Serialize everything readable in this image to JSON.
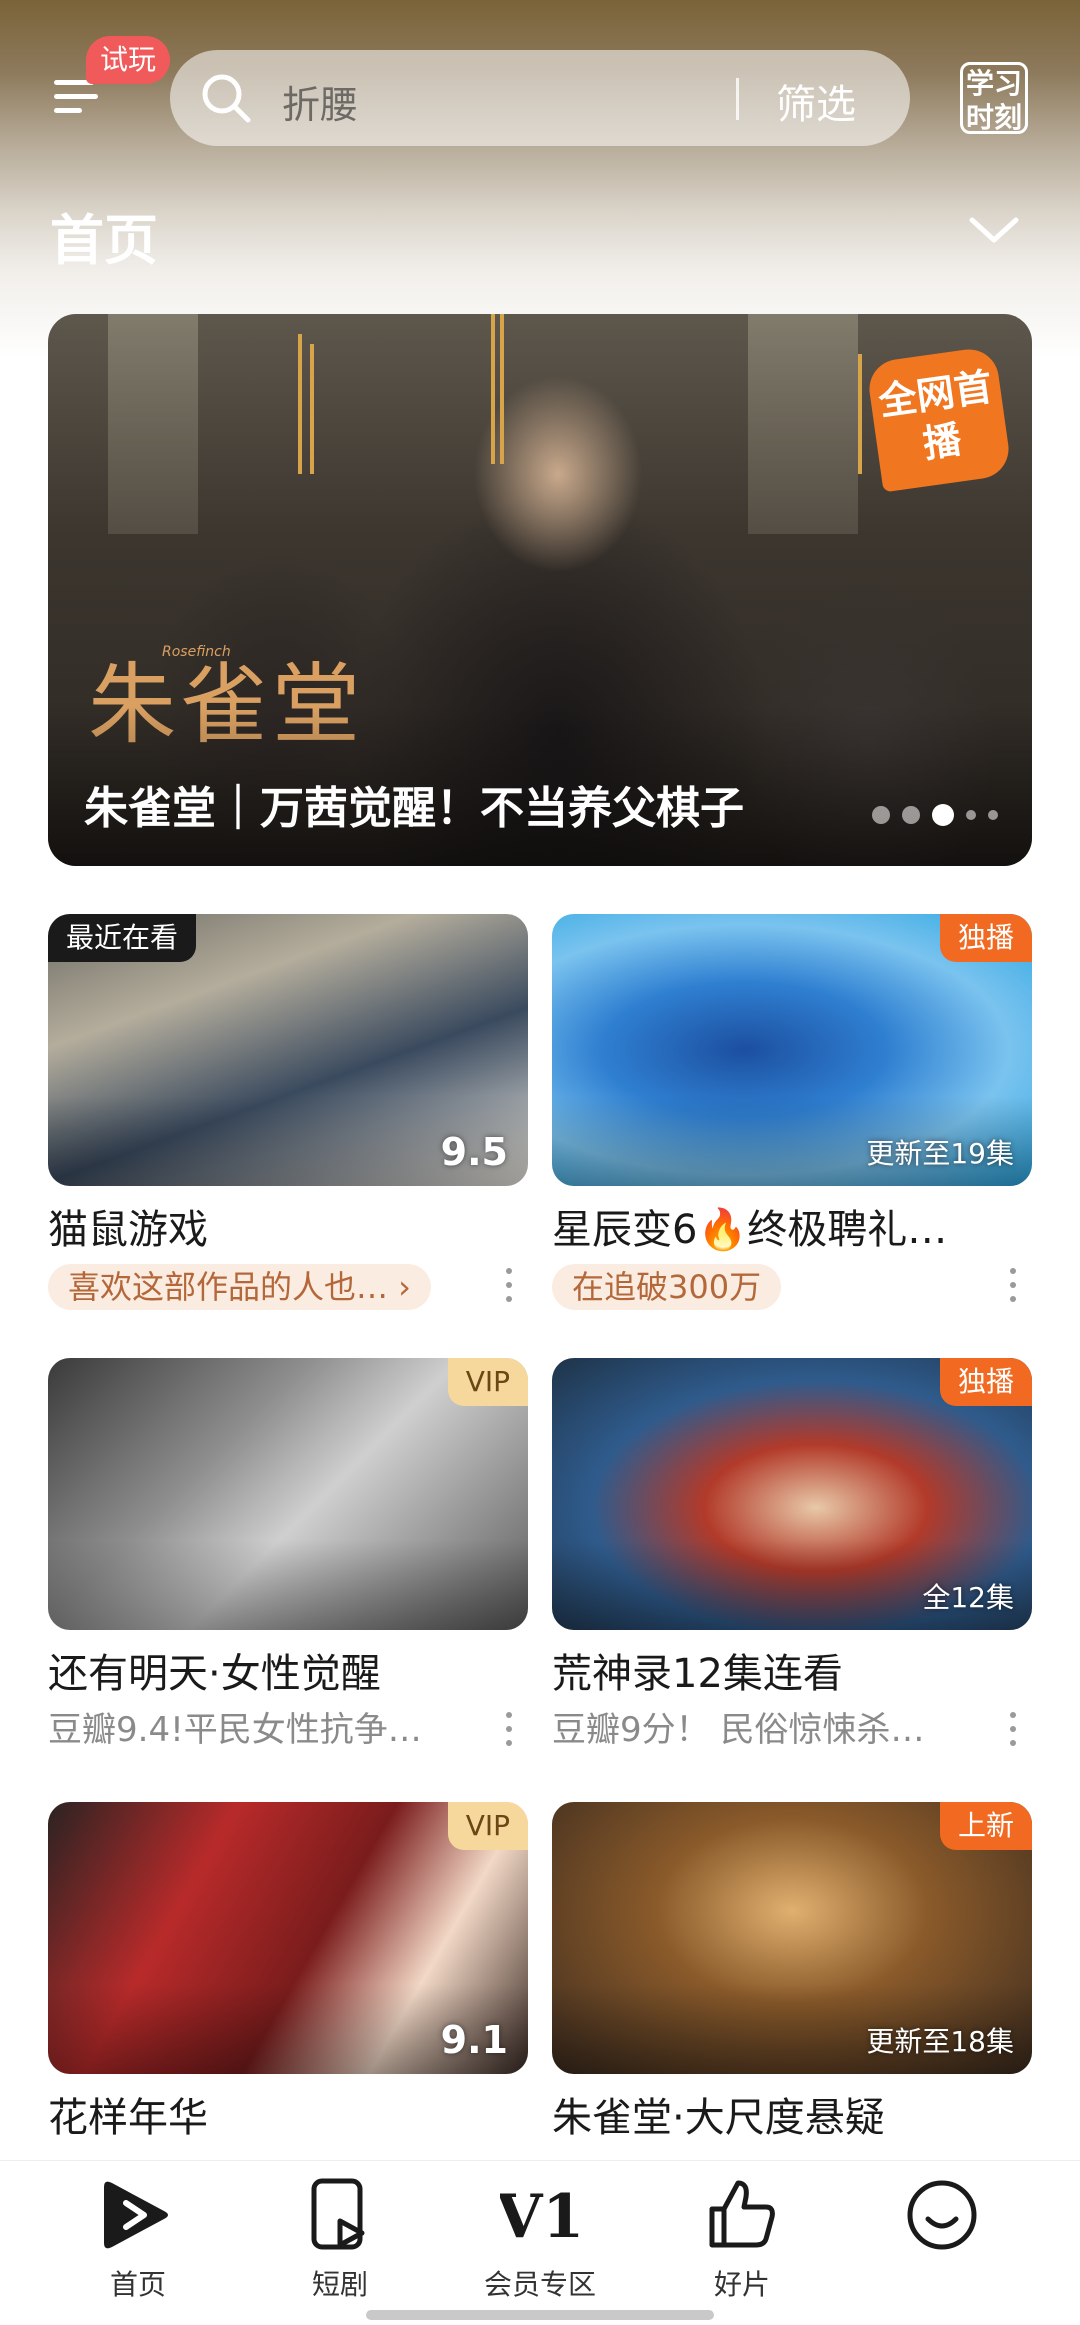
{
  "header": {
    "trial_badge": "试玩",
    "search_placeholder": "折腰",
    "filter_label": "筛选",
    "study_icon_text": "学习时刻",
    "page_title": "首页"
  },
  "banner": {
    "calligraphy": "朱雀堂",
    "calligraphy_sub": "Rosefinch",
    "caption": "朱雀堂｜万茜觉醒！不当养父棋子",
    "corner_badge": "全网首播",
    "active_dot": 3,
    "dot_count": 5
  },
  "cards": [
    {
      "title": "猫鼠游戏",
      "tag": "最近在看",
      "tag_style": "left",
      "rating": "9.5",
      "episodes": "",
      "pill": "喜欢这部作品的人也… ›",
      "subtext": "",
      "bg": "linear-gradient(160deg,#6d6a63 0%,#b4ad9c 30%,#3a4a5e 60%,#f2eee6 100%)"
    },
    {
      "title": "星辰变6🔥终极聘礼…",
      "tag": "独播",
      "tag_style": "orange",
      "rating": "",
      "episodes": "更新至19集",
      "pill": "在追破300万",
      "subtext": "",
      "bg": "radial-gradient(ellipse at 40% 50%,#1c4fa0 0%,#2f7fd1 35%,#7ac3ef 65%,#2aa6e0 100%)"
    },
    {
      "title": "还有明天·女性觉醒",
      "tag": "VIP",
      "tag_style": "vip",
      "rating": "",
      "episodes": "",
      "pill": "",
      "subtext": "豆瓣9.4!平民女性抗争…",
      "bg": "linear-gradient(135deg,#3a3a3a 0%,#8e8e8e 35%,#cfcfcf 55%,#5a5a5a 100%)"
    },
    {
      "title": "荒神录12集连看",
      "tag": "独播",
      "tag_style": "orange",
      "rating": "",
      "episodes": "全12集",
      "pill": "",
      "subtext": "豆瓣9分！ 民俗惊悚杀…",
      "bg": "radial-gradient(ellipse at 55% 55%,#e8c9a8 0%,#b23a2a 30%,#2f5b8c 60%,#1e3348 100%)"
    },
    {
      "title": "花样年华",
      "tag": "VIP",
      "tag_style": "vip",
      "rating": "9.1",
      "episodes": "",
      "pill": "",
      "subtext": "",
      "bg": "linear-gradient(120deg,#2a2322 0%,#b82a2a 30%,#7a1c1c 55%,#f2d8c6 75%,#3a2a24 100%)"
    },
    {
      "title": "朱雀堂·大尺度悬疑",
      "tag": "上新",
      "tag_style": "orange",
      "rating": "",
      "episodes": "更新至18集",
      "pill": "",
      "subtext": "",
      "bg": "radial-gradient(ellipse at 50% 40%,#e0b070 0%,#8a5a2a 40%,#3a2a1e 100%)"
    }
  ],
  "nav": [
    {
      "label": "首页",
      "icon": "play-home-icon",
      "active": true
    },
    {
      "label": "短剧",
      "icon": "short-drama-icon",
      "active": false
    },
    {
      "label": "会员专区",
      "icon": "vip-zone-icon",
      "active": false
    },
    {
      "label": "好片",
      "icon": "thumbs-up-icon",
      "active": false
    },
    {
      "label": "",
      "icon": "smile-face-icon",
      "active": false
    }
  ],
  "colors": {
    "accent_orange": "#f26a21",
    "trial_red": "#f05a5a",
    "vip_gold": "#f6d79c"
  }
}
